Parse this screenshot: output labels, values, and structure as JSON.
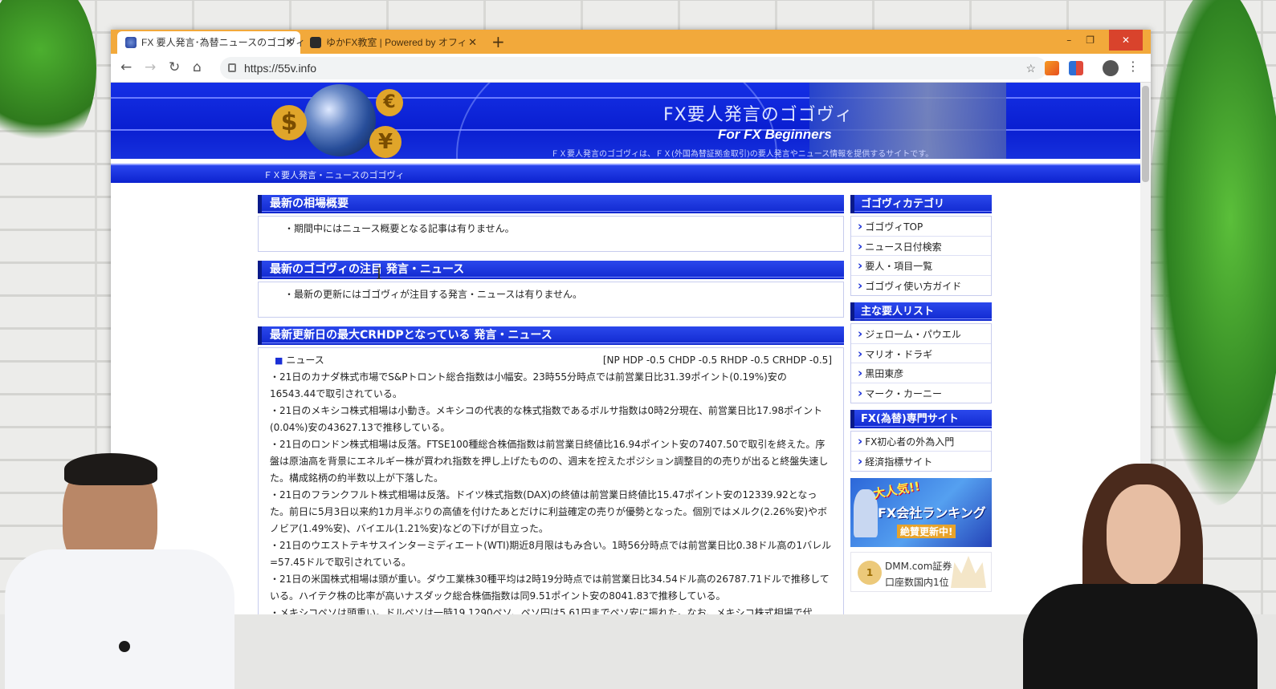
{
  "browser": {
    "tabs": [
      {
        "title": "FX 要人発言･為替ニュースのゴゴヴィ",
        "active": true
      },
      {
        "title": "ゆかFX教室 | Powered by オフィ",
        "active": false
      }
    ],
    "new_tab_symbol": "+",
    "window_controls": [
      "–",
      "❐",
      "✕"
    ],
    "url": "https://55v.info"
  },
  "banner": {
    "title": "FX要人発言のゴゴヴィ",
    "subtitle": "For FX Beginners",
    "description": "ＦＸ要人発言のゴゴヴィは、ＦＸ(外国為替証拠金取引)の要人発言やニュース情報を提供するサイトです。",
    "coin_symbols": [
      "$",
      "¥",
      "€"
    ]
  },
  "breadcrumb": "ＦＸ要人発言・ニュースのゴゴヴィ",
  "sections": [
    {
      "heading": "最新の相場概要",
      "body": "・期間中にはニュース概要となる記事は有りません。"
    },
    {
      "heading": "最新のゴゴヴィの注目 発言・ニュース",
      "body": "・最新の更新にはゴゴヴィが注目する発言・ニュースは有りません。"
    }
  ],
  "news_section": {
    "heading": "最新更新日の最大CRHDPとなっている 発言・ニュース",
    "label": "ニュース",
    "metrics": "[NP HDP -0.5 CHDP -0.5 RHDP -0.5 CRHDP -0.5]",
    "paragraphs": [
      "・21日のカナダ株式市場でS&Pトロント総合指数は小幅安。23時55分時点では前営業日比31.39ポイント(0.19%)安の16543.44で取引されている。",
      "・21日のメキシコ株式相場は小動き。メキシコの代表的な株式指数であるボルサ指数は0時2分現在、前営業日比17.98ポイント(0.04%)安の43627.13で推移している。",
      "・21日のロンドン株式相場は反落。FTSE100種総合株価指数は前営業日終値比16.94ポイント安の7407.50で取引を終えた。序盤は原油高を背景にエネルギー株が買われ指数を押し上げたものの、週末を控えたポジション調整目的の売りが出ると終盤失速した。構成銘柄の約半数以上が下落した。",
      "・21日のフランクフルト株式相場は反落。ドイツ株式指数(DAX)の終値は前営業日終値比15.47ポイント安の12339.92となった。前日に5月3日以来約1カ月半ぶりの高値を付けたあとだけに利益確定の売りが優勢となった。個別ではメルク(2.26%安)やボノビア(1.49%安)、バイエル(1.21%安)などの下げが目立った。",
      "・21日のウエストテキサスインターミディエート(WTI)期近8月限はもみ合い。1時56分時点では前営業日比0.38ドル高の1バレル=57.45ドルで取引されている。",
      "・21日の米国株式相場は頭が重い。ダウ工業株30種平均は2時19分時点では前営業日比34.54ドル高の26787.71ドルで推移している。ハイテク株の比率が高いナスダック総合株価指数は同9.51ポイント安の8041.83で推移している。",
      "・メキシコペソは頭重い。ドルペソは一時19.1290ペソ、ペソ円は5.61円までペソ安に振れた。なお、メキシコ株式相場で代"
    ]
  },
  "sidebar": {
    "category_heading": "ゴゴヴィカテゴリ",
    "categories": [
      "ゴゴヴィTOP",
      "ニュース日付検索",
      "要人・項目一覧",
      "ゴゴヴィ使い方ガイド"
    ],
    "people_heading": "主な要人リスト",
    "people": [
      "ジェローム・パウエル",
      "マリオ・ドラギ",
      "黒田東彦",
      "マーク・カーニー"
    ],
    "sites_heading": "FX(為替)専門サイト",
    "sites": [
      "FX初心者の外為入門",
      "経済指標サイト"
    ],
    "rank_banner": {
      "line1": "大人気!!",
      "line2": "FX会社ランキング",
      "line3": "絶賛更新中!"
    },
    "broker": {
      "name": "DMM.com証券",
      "note": "口座数国内1位",
      "medal": "1"
    }
  },
  "colors": {
    "tab_strip": "#f2a93b",
    "banner_blue": "#0a1fd1",
    "section_blue": "#1a2fd6"
  }
}
